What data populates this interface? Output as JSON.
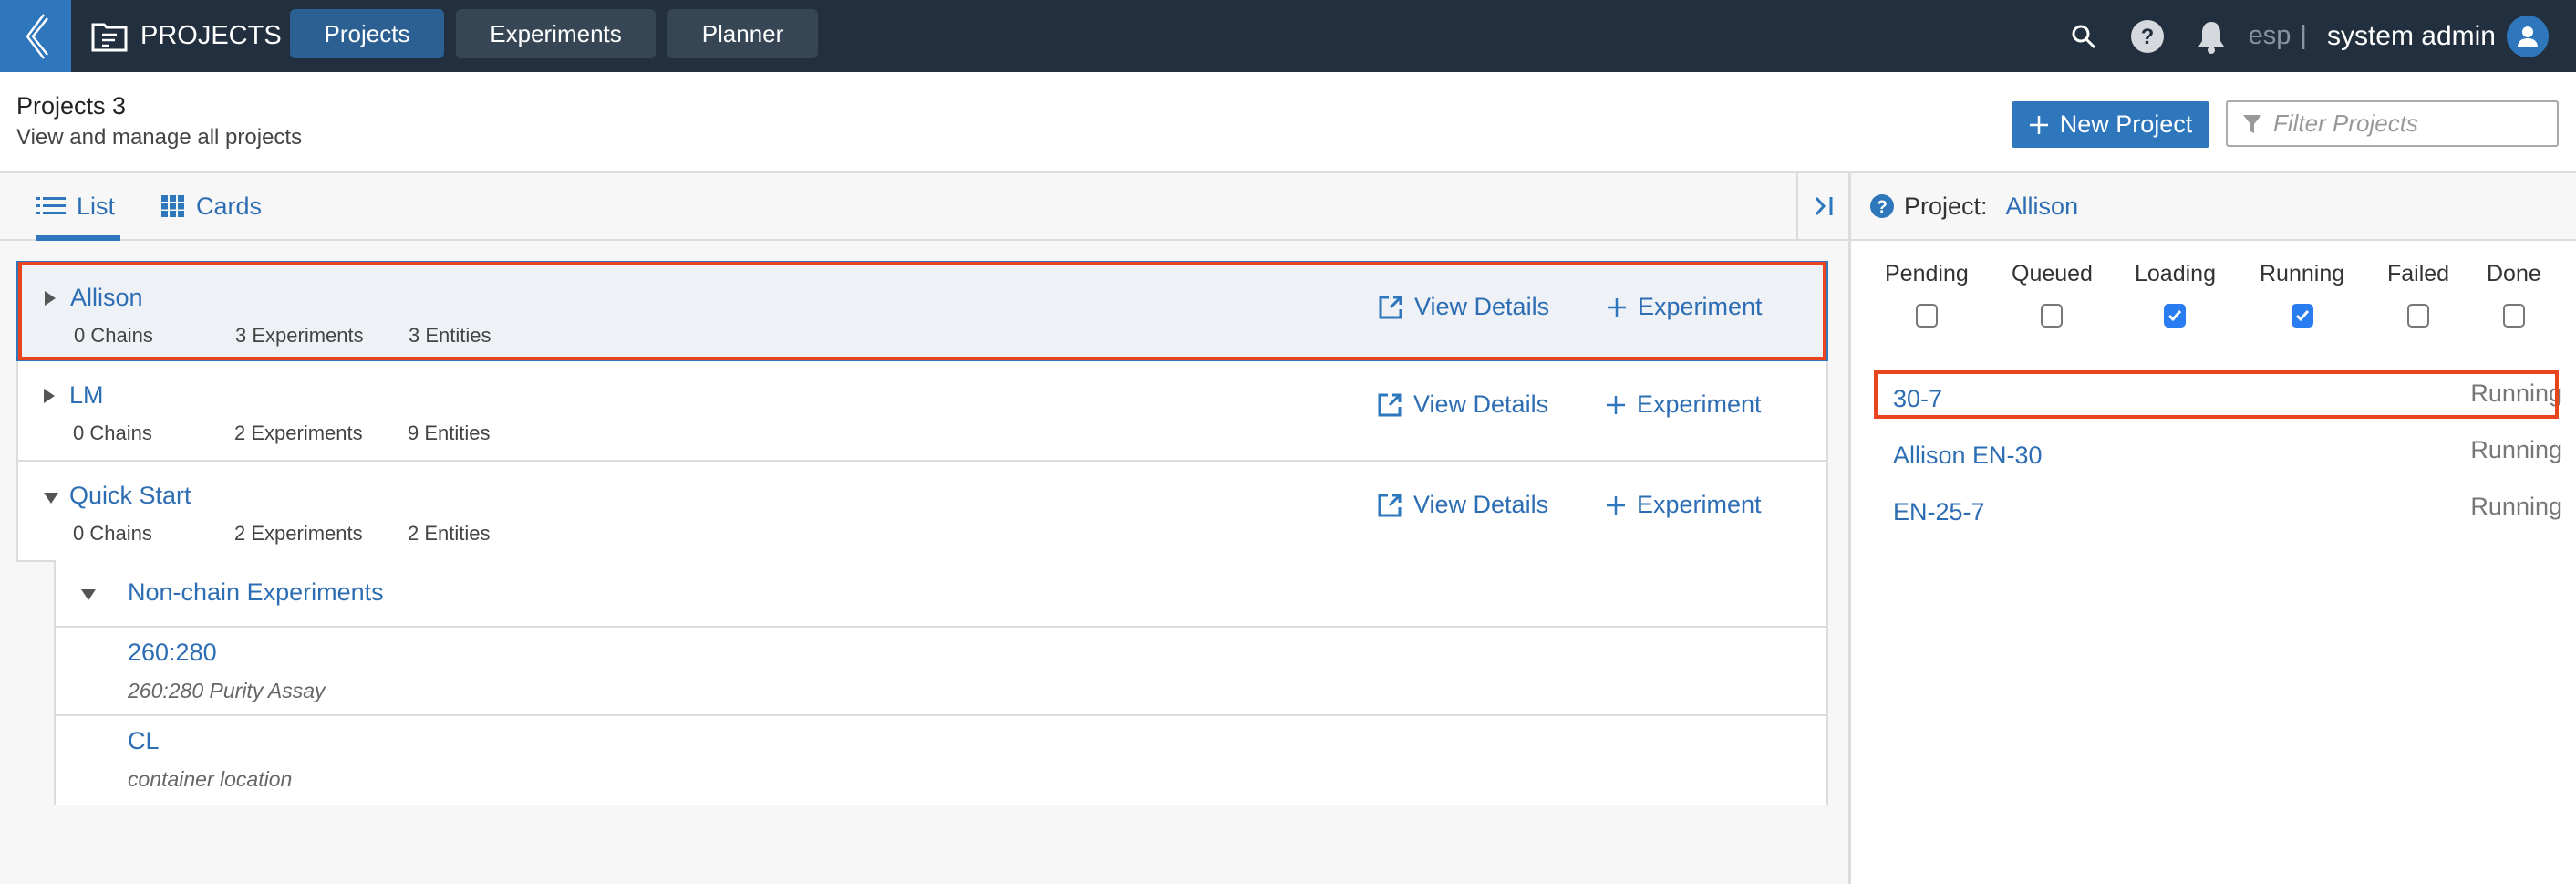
{
  "nav": {
    "app_title": "PROJECTS",
    "buttons": [
      {
        "label": "Projects",
        "active": true
      },
      {
        "label": "Experiments",
        "active": false
      },
      {
        "label": "Planner",
        "active": false
      }
    ],
    "tenant": "esp",
    "separator": "|",
    "user": "system admin"
  },
  "header": {
    "title": "Projects 3",
    "subtitle": "View and manage all projects",
    "new_button_label": "New Project",
    "filter_placeholder": "Filter Projects",
    "filter_value": ""
  },
  "tabs": [
    {
      "label": "List",
      "icon": "list-icon",
      "active": true
    },
    {
      "label": "Cards",
      "icon": "grid-icon",
      "active": false
    }
  ],
  "projects": [
    {
      "name": "Allison",
      "expanded": false,
      "selected": true,
      "chains": "0 Chains",
      "experiments": "3 Experiments",
      "entities": "3 Entities",
      "view_label": "View Details",
      "add_label": "Experiment"
    },
    {
      "name": "LM",
      "expanded": false,
      "selected": false,
      "chains": "0 Chains",
      "experiments": "2 Experiments",
      "entities": "9 Entities",
      "view_label": "View Details",
      "add_label": "Experiment"
    },
    {
      "name": "Quick Start",
      "expanded": true,
      "selected": false,
      "chains": "0 Chains",
      "experiments": "2 Experiments",
      "entities": "2 Entities",
      "view_label": "View Details",
      "add_label": "Experiment"
    }
  ],
  "quick_start_children": {
    "group_title": "Non-chain Experiments",
    "items": [
      {
        "name": "260:280",
        "description": "260:280 Purity Assay"
      },
      {
        "name": "CL",
        "description": "container location"
      }
    ]
  },
  "right_panel": {
    "label": "Project:",
    "project": "Allison",
    "status_filters": [
      {
        "label": "Pending",
        "checked": false
      },
      {
        "label": "Queued",
        "checked": false
      },
      {
        "label": "Loading",
        "checked": true
      },
      {
        "label": "Running",
        "checked": true
      },
      {
        "label": "Failed",
        "checked": false
      },
      {
        "label": "Done",
        "checked": false
      }
    ],
    "experiments": [
      {
        "name": "30-7",
        "status": "Running"
      },
      {
        "name": "Allison EN-30",
        "status": "Running"
      },
      {
        "name": "EN-25-7",
        "status": "Running"
      }
    ]
  },
  "colors": {
    "nav_bg": "#222f3e",
    "accent": "#2f77bc",
    "link": "#2d6db3",
    "highlight": "#e8451f",
    "checkbox_checked": "#2a7df0"
  }
}
